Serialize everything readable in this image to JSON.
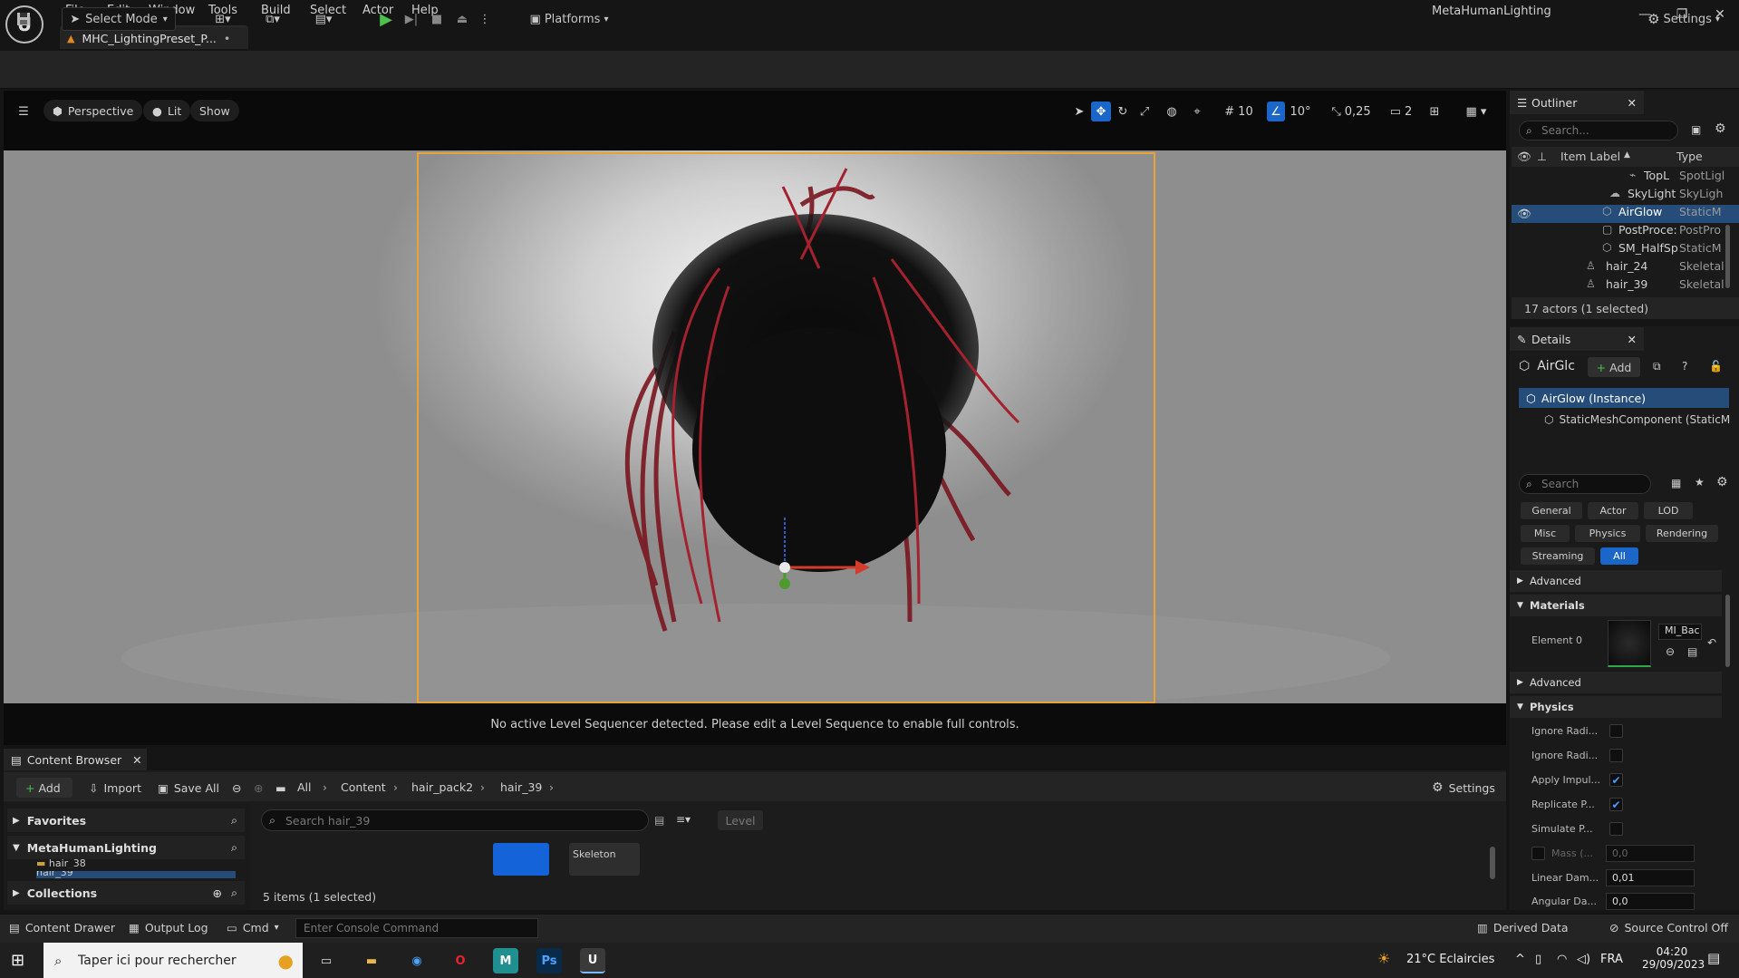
{
  "menu": [
    "File",
    "Edit",
    "Window",
    "Tools",
    "Build",
    "Select",
    "Actor",
    "Help"
  ],
  "app_title": "MetaHumanLighting",
  "doc_tab": "MHC_LightingPreset_P...",
  "toolbar": {
    "select_mode": "Select Mode",
    "platforms": "Platforms",
    "settings": "Settings"
  },
  "viewport": {
    "perspective": "Perspective",
    "lit": "Lit",
    "show": "Show",
    "grid_snap": "10",
    "rot_snap": "10°",
    "scale_snap": "0,25",
    "camera_speed": "2",
    "message": "No active Level Sequencer detected. Please edit a Level Sequence to enable full controls."
  },
  "outliner": {
    "title": "Outliner",
    "search_placeholder": "Search...",
    "col_label": "Item Label",
    "col_type": "Type",
    "rows": [
      {
        "label": "TopL",
        "type": "SpotLigl"
      },
      {
        "label": "SkyLight",
        "type": "SkyLigh"
      },
      {
        "label": "AirGlow",
        "type": "StaticM"
      },
      {
        "label": "PostProce:",
        "type": "PostPro"
      },
      {
        "label": "SM_HalfSp",
        "type": "StaticM"
      },
      {
        "label": "hair_24",
        "type": "Skeletal"
      },
      {
        "label": "hair_39",
        "type": "Skeletal"
      }
    ],
    "status": "17 actors (1 selected)"
  },
  "details": {
    "title": "Details",
    "actor_name": "AirGlc",
    "add": "Add",
    "instance": "AirGlow (Instance)",
    "component": "StaticMeshComponent (StaticM",
    "search_placeholder": "Search",
    "filters": [
      "General",
      "Actor",
      "LOD",
      "Misc",
      "Physics",
      "Rendering",
      "Streaming",
      "All"
    ],
    "advanced": "Advanced",
    "materials": "Materials",
    "element0": "Element 0",
    "material_name": "MI_Bac",
    "physics": "Physics",
    "props": [
      {
        "label": "Ignore Radi...",
        "checked": false
      },
      {
        "label": "Ignore Radi...",
        "checked": false
      },
      {
        "label": "Apply Impul...",
        "checked": true
      },
      {
        "label": "Replicate P...",
        "checked": true
      },
      {
        "label": "Simulate P...",
        "checked": false
      }
    ],
    "mass_label": "Mass (...",
    "mass_value": "0,0",
    "linear_damping_label": "Linear Dam...",
    "linear_damping": "0,01",
    "angular_damping_label": "Angular Da...",
    "angular_damping": "0,0"
  },
  "content_browser": {
    "title": "Content Browser",
    "add": "Add",
    "import": "Import",
    "save_all": "Save All",
    "crumbs": [
      "All",
      "Content",
      "hair_pack2",
      "hair_39"
    ],
    "settings": "Settings",
    "favorites": "Favorites",
    "project": "MetaHumanLighting",
    "folder1": "hair_38",
    "folder2": "hair_39",
    "collections": "Collections",
    "search_placeholder": "Search hair_39",
    "level": "Level",
    "asset_label": "Skeleton",
    "status": "5 items (1 selected)"
  },
  "statusbar": {
    "content_drawer": "Content Drawer",
    "output_log": "Output Log",
    "cmd": "Cmd",
    "console_placeholder": "Enter Console Command",
    "derived_data": "Derived Data",
    "source_control": "Source Control Off"
  },
  "taskbar": {
    "search": "Taper ici pour rechercher",
    "weather": "21°C  Eclaircies",
    "lang": "FRA",
    "time": "04:20",
    "date": "29/09/2023"
  }
}
